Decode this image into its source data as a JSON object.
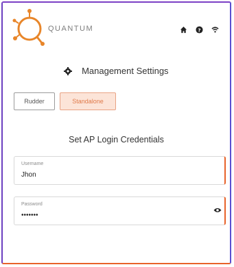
{
  "header": {
    "brand_name": "QUANTUM",
    "tagline": "",
    "icons": [
      "home-icon",
      "help-icon",
      "wifi-icon"
    ]
  },
  "settings": {
    "title": "Management Settings",
    "icon": "gear-icon"
  },
  "modes": {
    "options": [
      "Rudder",
      "Standalone"
    ],
    "selected": "Standalone"
  },
  "credentials": {
    "title": "Set AP Login Credentials",
    "username": {
      "label": "Username",
      "value": "Jhon"
    },
    "password": {
      "label": "Password",
      "value": "•••••••"
    }
  },
  "colors": {
    "accent": "#e8622a",
    "selected_bg": "#fce4d8",
    "frame": "#7a3ec4"
  }
}
